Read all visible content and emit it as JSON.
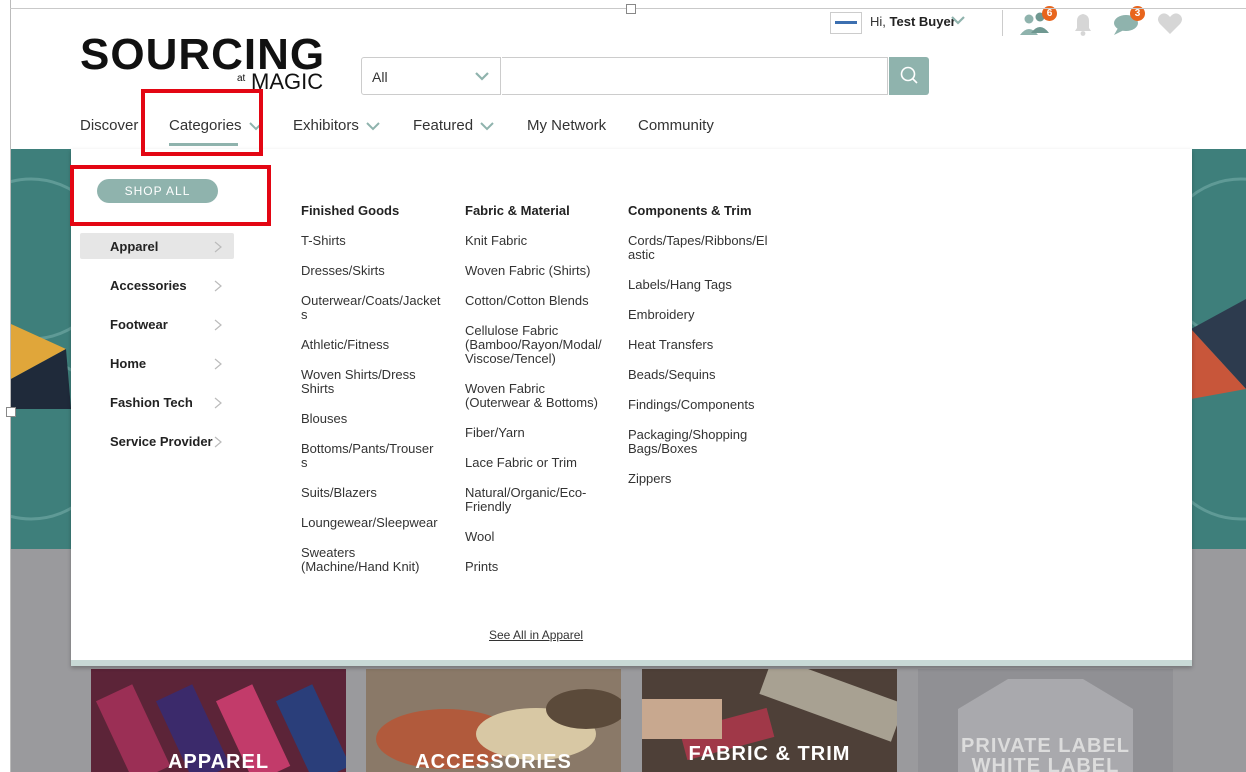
{
  "header": {
    "logo_main": "SOURCING",
    "logo_at": "at",
    "logo_magic": "MAGIC",
    "search": {
      "category_value": "All",
      "query_value": "",
      "icon": "search-icon"
    },
    "greeting_prefix": "Hi,",
    "user_name": "Test Buyer",
    "badges": {
      "network": "6",
      "messages": "3"
    },
    "icons": [
      "connections-icon",
      "bell-icon",
      "chat-icon",
      "heart-icon"
    ]
  },
  "nav": {
    "items": [
      {
        "label": "Discover",
        "has_dropdown": false
      },
      {
        "label": "Categories",
        "has_dropdown": true,
        "active": true
      },
      {
        "label": "Exhibitors",
        "has_dropdown": true
      },
      {
        "label": "Featured",
        "has_dropdown": true
      },
      {
        "label": "My Network",
        "has_dropdown": false
      },
      {
        "label": "Community",
        "has_dropdown": false
      }
    ]
  },
  "menu": {
    "shop_all": "SHOP ALL",
    "categories": [
      {
        "label": "Apparel",
        "active": true
      },
      {
        "label": "Accessories"
      },
      {
        "label": "Footwear"
      },
      {
        "label": "Home"
      },
      {
        "label": "Fashion Tech"
      },
      {
        "label": "Service Provider"
      }
    ],
    "columns": [
      {
        "heading": "Finished Goods",
        "links": [
          "T-Shirts",
          "Dresses/Skirts",
          "Outerwear/Coats/Jacket\ns",
          "Athletic/Fitness",
          "Woven Shirts/Dress\nShirts",
          "Blouses",
          "Bottoms/Pants/Trouser\ns",
          "Suits/Blazers",
          "Loungewear/Sleepwear",
          "Sweaters\n(Machine/Hand Knit)"
        ]
      },
      {
        "heading": "Fabric & Material",
        "links": [
          "Knit Fabric",
          "Woven Fabric (Shirts)",
          "Cotton/Cotton Blends",
          "Cellulose Fabric\n(Bamboo/Rayon/Modal/\nViscose/Tencel)",
          "Woven Fabric\n(Outerwear & Bottoms)",
          "Fiber/Yarn",
          "Lace Fabric or Trim",
          "Natural/Organic/Eco-\nFriendly",
          "Wool",
          "Prints"
        ]
      },
      {
        "heading": "Components & Trim",
        "links": [
          "Cords/Tapes/Ribbons/El\nastic",
          "Labels/Hang Tags",
          "Embroidery",
          "Heat Transfers",
          "Beads/Sequins",
          "Findings/Components",
          "Packaging/Shopping\nBags/Boxes",
          "Zippers"
        ]
      }
    ],
    "see_all": "See All in Apparel"
  },
  "tiles": [
    {
      "label": "APPAREL"
    },
    {
      "label": "ACCESSORIES"
    },
    {
      "label": "FABRIC & TRIM"
    },
    {
      "label": "PRIVATE LABEL\nWHITE LABEL"
    }
  ],
  "colors": {
    "accent": "#8fb3ad",
    "badge": "#e8651d",
    "highlight": "#e30613",
    "hero": "#3e7f7b"
  }
}
